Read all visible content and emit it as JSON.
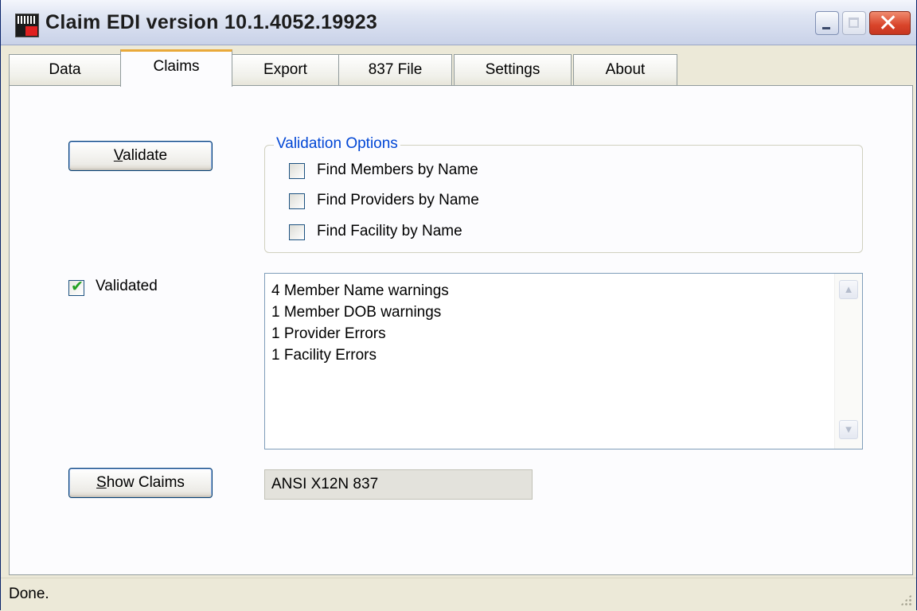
{
  "window": {
    "title": "Claim EDI version 10.1.4052.19923",
    "minimize_icon": "minimize-icon",
    "maximize_icon": "maximize-icon",
    "close_icon": "close-icon"
  },
  "tabs": [
    {
      "label": "Data",
      "active": false
    },
    {
      "label": "Claims",
      "active": true
    },
    {
      "label": "Export",
      "active": false
    },
    {
      "label": "837 File",
      "active": false
    },
    {
      "label": "Settings",
      "active": false
    },
    {
      "label": "About",
      "active": false
    }
  ],
  "claims": {
    "validate_button": {
      "label_mnemonic": "V",
      "label_rest": "alidate"
    },
    "validation_options": {
      "title": "Validation Options",
      "options": [
        {
          "label": "Find Members by Name",
          "checked": false
        },
        {
          "label": "Find Providers by Name",
          "checked": false
        },
        {
          "label": "Find Facility by Name",
          "checked": false
        }
      ]
    },
    "validated": {
      "label": "Validated",
      "checked": true
    },
    "results": [
      "4 Member Name warnings",
      "1 Member DOB warnings",
      "1 Provider Errors",
      "1 Facility Errors"
    ],
    "show_claims_button": {
      "label_mnemonic": "S",
      "label_rest": "how Claims"
    },
    "format_field": "ANSI X12N 837"
  },
  "status": {
    "text": "Done."
  },
  "colors": {
    "active_tab_accent": "#e9a93a",
    "groupbox_title": "#0046d5",
    "checkmark": "#21a121",
    "close_button": "#d9442a"
  }
}
